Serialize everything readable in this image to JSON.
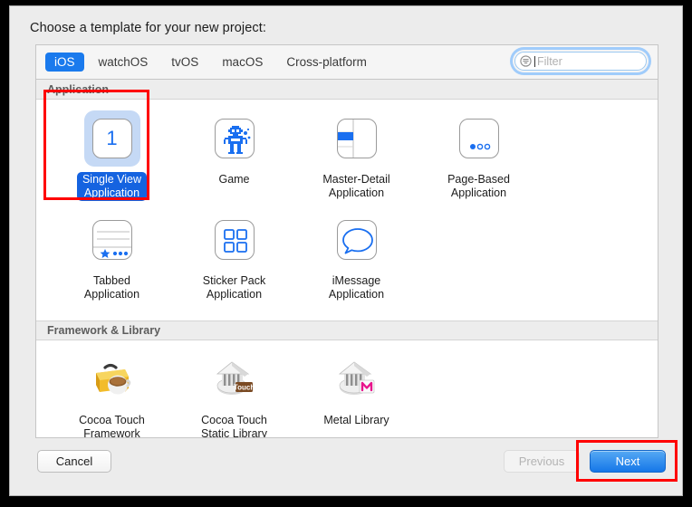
{
  "window": {
    "prompt": "Choose a template for your new project:"
  },
  "tabs": [
    {
      "label": "iOS",
      "active": true
    },
    {
      "label": "watchOS",
      "active": false
    },
    {
      "label": "tvOS",
      "active": false
    },
    {
      "label": "macOS",
      "active": false
    },
    {
      "label": "Cross-platform",
      "active": false
    }
  ],
  "filter": {
    "value": "",
    "placeholder": "Filter",
    "icon": "filter-lines-icon",
    "focused": true
  },
  "sections": [
    {
      "title": "Application",
      "items": [
        {
          "label": "Single View\nApplication",
          "icon": "single-view-icon",
          "selected": true
        },
        {
          "label": "Game",
          "icon": "game-robot-icon",
          "selected": false
        },
        {
          "label": "Master-Detail\nApplication",
          "icon": "master-detail-icon",
          "selected": false
        },
        {
          "label": "Page-Based\nApplication",
          "icon": "page-based-icon",
          "selected": false
        },
        {
          "label": "Tabbed\nApplication",
          "icon": "tabbed-icon",
          "selected": false
        },
        {
          "label": "Sticker Pack\nApplication",
          "icon": "sticker-pack-icon",
          "selected": false
        },
        {
          "label": "iMessage\nApplication",
          "icon": "imessage-bubble-icon",
          "selected": false
        }
      ]
    },
    {
      "title": "Framework & Library",
      "items": [
        {
          "label": "Cocoa Touch\nFramework",
          "icon": "toolbox-coffee-icon",
          "selected": false
        },
        {
          "label": "Cocoa Touch\nStatic Library",
          "icon": "library-building-touch-icon",
          "selected": false
        },
        {
          "label": "Metal Library",
          "icon": "library-building-metal-icon",
          "selected": false
        }
      ]
    }
  ],
  "buttons": {
    "cancel": "Cancel",
    "previous": "Previous",
    "next": "Next"
  },
  "colors": {
    "accent_blue": "#1a7aed",
    "selection_blue": "#1563e0",
    "annotation_red": "#ff0000",
    "icon_blue": "#1a6ff0"
  }
}
